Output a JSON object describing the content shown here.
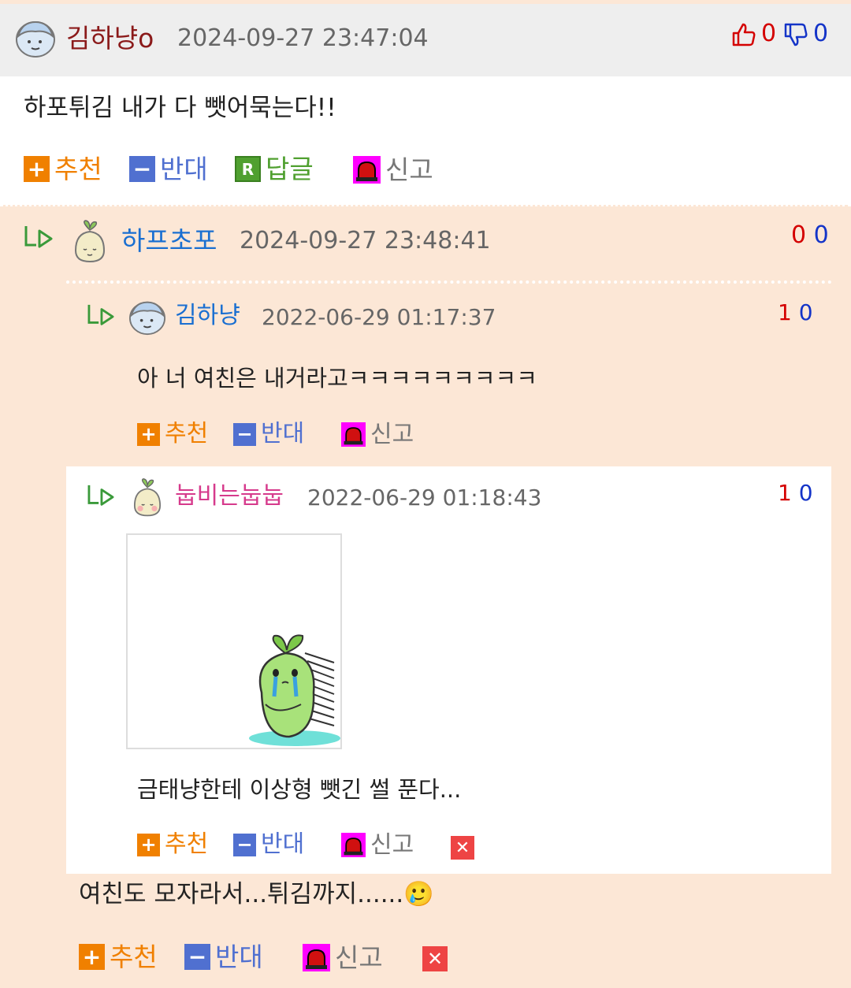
{
  "c1": {
    "nick": "김하냥o",
    "date": "2024-09-27 23:47:04",
    "likes": "0",
    "dislikes": "0",
    "text": "하포튀김 내가 다 뺏어묵는다!!",
    "actions": {
      "recommend": "추천",
      "oppose": "반대",
      "reply": "답글",
      "report": "신고"
    }
  },
  "c2": {
    "nick": "하프초포",
    "date": "2024-09-27 23:48:41",
    "likes": "0",
    "dislikes": "0",
    "text": "여친도 모자라서...튀김까지......",
    "emoji": "🥲",
    "actions": {
      "recommend": "추천",
      "oppose": "반대",
      "report": "신고"
    }
  },
  "q1": {
    "nick": "김하냥",
    "date": "2022-06-29 01:17:37",
    "likes": "1",
    "dislikes": "0",
    "text": "아 너 여친은 내거라고ㅋㅋㅋㅋㅋㅋㅋㅋㅋ",
    "actions": {
      "recommend": "추천",
      "oppose": "반대",
      "report": "신고"
    }
  },
  "q2": {
    "nick": "눕비는눕눕",
    "date": "2022-06-29 01:18:43",
    "likes": "1",
    "dislikes": "0",
    "text": "금태냥한테 이상형 뺏긴 썰 푼다...",
    "actions": {
      "recommend": "추천",
      "oppose": "반대",
      "report": "신고"
    }
  },
  "colors": {
    "nick_c1": "#8b1a1a",
    "nick_blue": "#1a6fd1",
    "nick_pink": "#d63a8c",
    "recommend": "#f08000",
    "oppose": "#5070d0",
    "reply": "#50a030",
    "report_bg": "#ff00ff"
  },
  "icons": [
    "avatar-boy-icon",
    "avatar-sprout-icon",
    "thumbs-up-icon",
    "thumbs-down-icon",
    "reply-arrow-icon",
    "plus-icon",
    "minus-icon",
    "reply-r-icon",
    "siren-icon",
    "delete-x-icon",
    "sticker-crying-sprout"
  ]
}
